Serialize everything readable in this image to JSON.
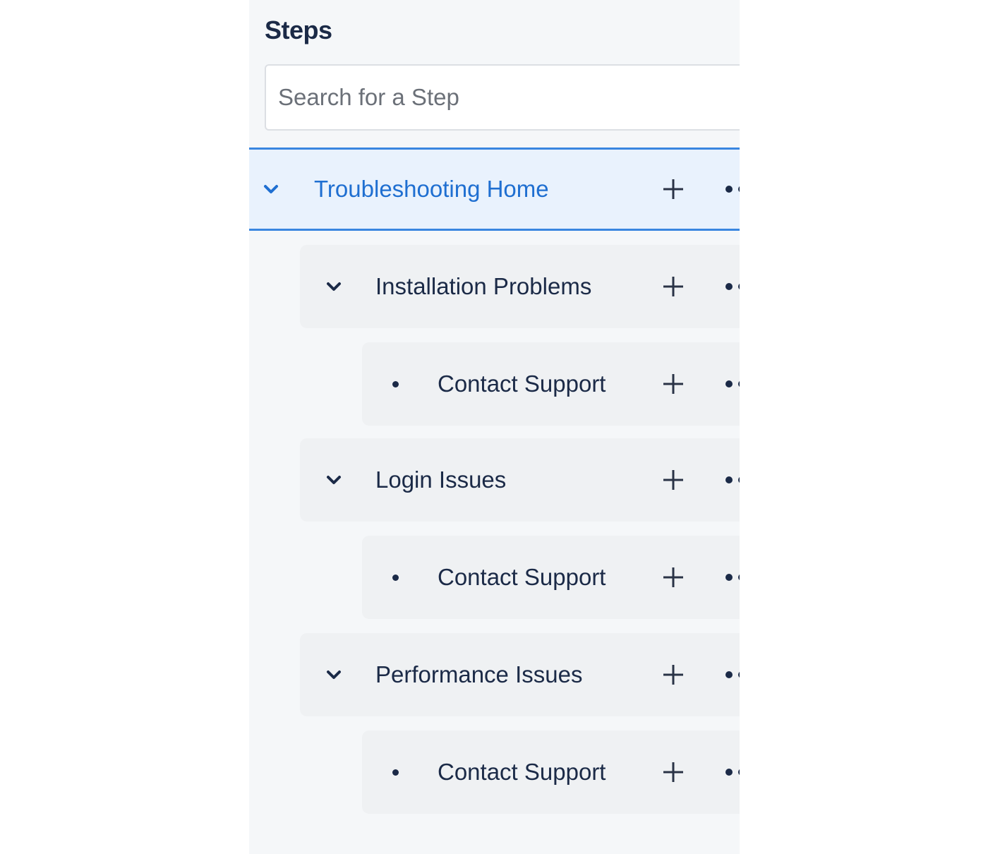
{
  "panel": {
    "title": "Steps",
    "search": {
      "placeholder": "Search for a Step",
      "value": ""
    }
  },
  "tree": {
    "root": {
      "label": "Troubleshooting Home",
      "expanded": true,
      "selected": true,
      "icon": "chevron-down-icon"
    },
    "groups": [
      {
        "label": "Installation Problems",
        "expanded": true,
        "children": [
          {
            "label": "Contact Support"
          }
        ]
      },
      {
        "label": "Login Issues",
        "expanded": true,
        "children": [
          {
            "label": "Contact Support"
          }
        ]
      },
      {
        "label": "Performance Issues",
        "expanded": true,
        "children": [
          {
            "label": "Contact Support"
          }
        ]
      }
    ],
    "actions": {
      "add_icon": "plus-icon",
      "more_icon": "more-options-icon"
    }
  },
  "colors": {
    "accent": "#3a86e0",
    "selected_text": "#1f6fd1",
    "text": "#1b2a47",
    "selected_bg": "#e9f2fd"
  }
}
